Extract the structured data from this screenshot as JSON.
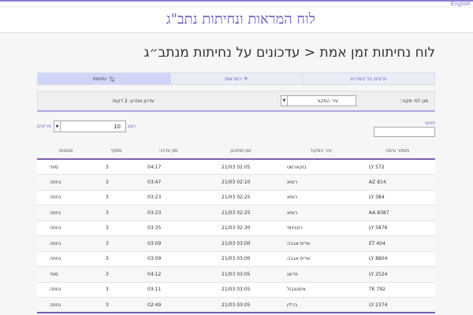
{
  "lang_link": "English",
  "site_title": "לוח המראות ונחיתות נתב\"ג",
  "page_title": "לוח נחיתות זמן אמת < עדכונים על נחיתות מנתב״ג",
  "tabs": [
    {
      "label": "פרסים על השירות",
      "icon": "",
      "active": false
    },
    {
      "label": "המראות",
      "icon": "✈",
      "active": false
    },
    {
      "label": "נחיתות",
      "icon": "🛬",
      "active": true
    }
  ],
  "filter": {
    "label": "סנן לפי מקור:",
    "select_value": "עיר המקור",
    "last_update": "עדכון אחרון: 2 דקות"
  },
  "search": {
    "label": "חפש:"
  },
  "length": {
    "show_label": "הצג",
    "value": "10",
    "items_label": "פריטים"
  },
  "table": {
    "headers": [
      "מספר טיסה",
      "עיר המקור",
      "זמן מתוכנן",
      "זמן עדכני",
      "מסוף",
      "סטטוס"
    ],
    "rows": [
      [
        "LY 572",
        "בוקארשט",
        "21/03 02:05",
        "04:17",
        "3",
        "סופי"
      ],
      [
        "AZ 814",
        "רומא",
        "21/03 02:10",
        "03:47",
        "3",
        "נחתה"
      ],
      [
        "LY 384",
        "רומא",
        "21/03 02:25",
        "03:23",
        "3",
        "נחתה"
      ],
      [
        "AA 8387",
        "רומא",
        "21/03 02:25",
        "03:23",
        "3",
        "נחתה"
      ],
      [
        "LY 5876",
        "רובנזימי",
        "21/03 02:30",
        "03:35",
        "3",
        "נחתה"
      ],
      [
        "ET 404",
        "אדיס אבבה",
        "21/03 03:00",
        "03:09",
        "3",
        "נחתה"
      ],
      [
        "LY 8804",
        "אדיס אבבה",
        "21/03 03:00",
        "03:09",
        "3",
        "נחתה"
      ],
      [
        "LY 2524",
        "פראג",
        "21/03 03:05",
        "04:12",
        "3",
        "סופי"
      ],
      [
        "TK 792",
        "איסטנבול",
        "21/03 03:05",
        "03:11",
        "3",
        "נחתה"
      ],
      [
        "LY 2374",
        "ברלין",
        "21/03 03:05",
        "02:49",
        "3",
        "נחתה"
      ]
    ]
  }
}
